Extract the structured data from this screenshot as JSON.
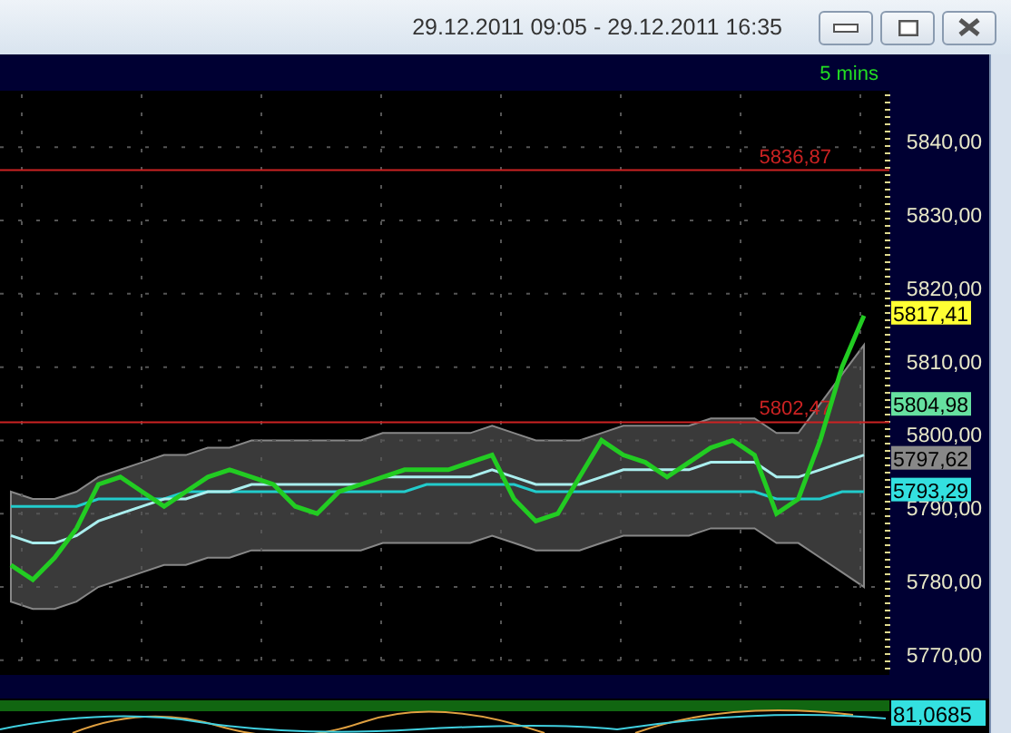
{
  "window": {
    "title": "29.12.2011 09:05 - 29.12.2011 16:35"
  },
  "chart": {
    "timeframe": "5 mins",
    "chart_data": {
      "type": "line",
      "grid": true,
      "ylim": [
        5768,
        5847.7
      ],
      "yticks": [
        {
          "value": 5840,
          "label": "5840,00"
        },
        {
          "value": 5830,
          "label": "5830,00"
        },
        {
          "value": 5820,
          "label": "5820,00"
        },
        {
          "value": 5810,
          "label": "5810,00"
        },
        {
          "value": 5800,
          "label": "5800,00"
        },
        {
          "value": 5790,
          "label": "5790,00"
        },
        {
          "value": 5780,
          "label": "5780,00"
        },
        {
          "value": 5770,
          "label": "5770,00"
        }
      ],
      "series": [
        {
          "color": "#22cc22",
          "values": [
            5783,
            5781,
            5784,
            5788,
            5794,
            5795,
            5793,
            5791,
            5793,
            5795,
            5796,
            5795,
            5794,
            5791,
            5790,
            5793,
            5794,
            5795,
            5796,
            5796,
            5796,
            5797,
            5798,
            5792,
            5789,
            5790,
            5795,
            5800,
            5798,
            5797,
            5795,
            5797,
            5799,
            5800,
            5798,
            5790,
            5792,
            5800,
            5810,
            5817
          ]
        },
        {
          "color": "#aaeeee",
          "values": [
            5787,
            5786,
            5786,
            5787,
            5789,
            5790,
            5791,
            5792,
            5792,
            5793,
            5793,
            5794,
            5794,
            5794,
            5794,
            5794,
            5794,
            5795,
            5795,
            5795,
            5795,
            5795,
            5796,
            5795,
            5794,
            5794,
            5794,
            5795,
            5796,
            5796,
            5796,
            5796,
            5797,
            5797,
            5797,
            5795,
            5795,
            5796,
            5797,
            5798
          ]
        },
        {
          "color": "#22cccc",
          "values": [
            5791,
            5791,
            5791,
            5791,
            5792,
            5792,
            5792,
            5792,
            5793,
            5793,
            5793,
            5793,
            5793,
            5793,
            5793,
            5793,
            5793,
            5793,
            5793,
            5794,
            5794,
            5794,
            5794,
            5794,
            5793,
            5793,
            5793,
            5793,
            5793,
            5793,
            5793,
            5793,
            5793,
            5793,
            5793,
            5792,
            5792,
            5792,
            5793,
            5793
          ]
        }
      ],
      "ref_lines": [
        {
          "axis": "y",
          "value": 5836.87,
          "label": "5836,87",
          "color": "#cc2222"
        },
        {
          "axis": "y",
          "value": 5802.47,
          "label": "5802,47",
          "color": "#cc2222"
        }
      ]
    },
    "price_tags": [
      {
        "label": "5817,41",
        "color": "#ffff33"
      },
      {
        "label": "5804,98",
        "color": "#66e0a0"
      },
      {
        "label": "5797,62",
        "color": "#888888"
      },
      {
        "label": "5793,29",
        "color": "#33e0e0"
      }
    ]
  },
  "indicator": {
    "reading": "81,0685"
  }
}
